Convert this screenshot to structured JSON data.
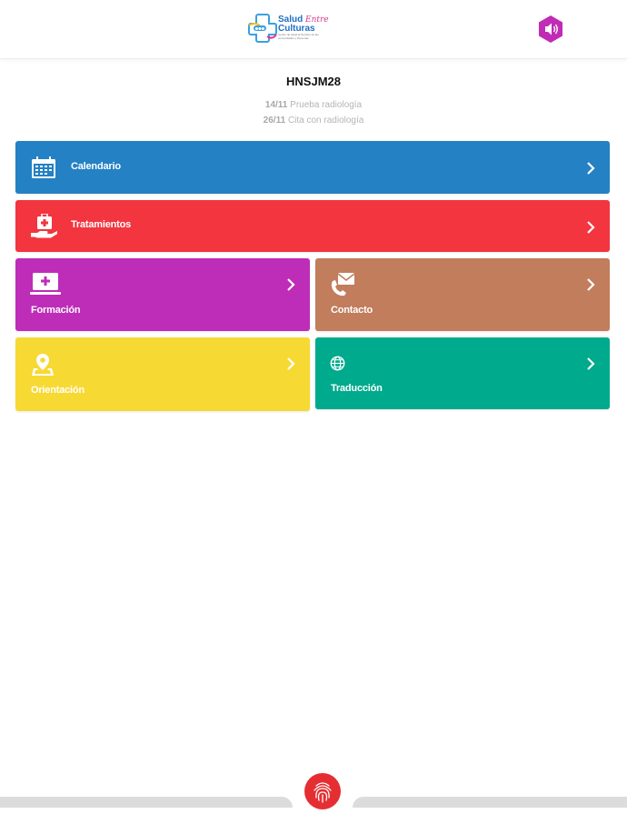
{
  "header": {
    "logo": {
      "title_main": "Salud",
      "title_em": "Entre",
      "title_second": "Culturas",
      "icon_text": "●●●",
      "subtitle": "Centro de salud al Servicio de las comunidades y Personas"
    },
    "sound_icon": "speaker-icon"
  },
  "user": {
    "name": "HNSJM28"
  },
  "appointments": [
    {
      "date": "14/11",
      "text": "Prueba radiología"
    },
    {
      "date": "26/11",
      "text": "Cita con radiología"
    }
  ],
  "tiles": {
    "calendario": {
      "label": "Calendario",
      "color": "#2481c4",
      "icon": "calendar-icon"
    },
    "tratamientos": {
      "label": "Tratamientos",
      "color": "#f2353f",
      "icon": "medkit-hand-icon"
    },
    "formacion": {
      "label": "Formación",
      "color": "#be2db8",
      "icon": "laptop-medical-icon"
    },
    "contacto": {
      "label": "Contacto",
      "color": "#c17d5c",
      "icon": "phone-mail-icon"
    },
    "orientacion": {
      "label": "Orientación",
      "color": "#f7d934",
      "icon": "map-pin-icon"
    },
    "traduccion": {
      "label": "Traducción",
      "color": "#00aa8c",
      "icon": "globe-icon"
    }
  },
  "bottom": {
    "fingerprint_icon": "fingerprint-icon",
    "accent": "#e52e32"
  }
}
